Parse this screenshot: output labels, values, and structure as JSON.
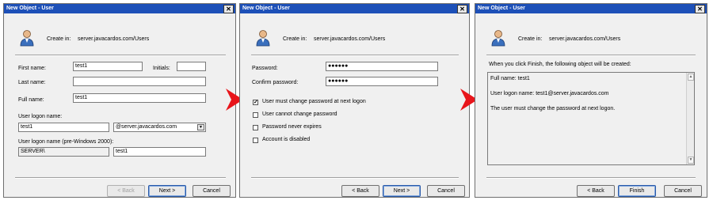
{
  "dialog1": {
    "title": "New Object - User",
    "create_in_label": "Create in:",
    "create_in_path": "server.javacardos.com/Users",
    "first_name_label": "First name:",
    "first_name_value": "test1",
    "initials_label": "Initials:",
    "initials_value": "",
    "last_name_label": "Last name:",
    "last_name_value": "",
    "full_name_label": "Full name:",
    "full_name_value": "test1",
    "logon_name_label": "User logon name:",
    "logon_name_value": "test1",
    "domain_value": "@server.javacardos.com",
    "pre2000_label": "User logon name (pre-Windows 2000):",
    "pre2000_domain_value": "SERVER\\",
    "pre2000_name_value": "test1",
    "back_label": "< Back",
    "next_label": "Next >",
    "cancel_label": "Cancel"
  },
  "dialog2": {
    "title": "New Object - User",
    "create_in_label": "Create in:",
    "create_in_path": "server.javacardos.com/Users",
    "password_label": "Password:",
    "password_value": "●●●●●●",
    "confirm_label": "Confirm password:",
    "confirm_value": "●●●●●●",
    "options": [
      {
        "label": "User must change password at next logon",
        "checked": true
      },
      {
        "label": "User cannot change password",
        "checked": false
      },
      {
        "label": "Password never expires",
        "checked": false
      },
      {
        "label": "Account is disabled",
        "checked": false
      }
    ],
    "back_label": "< Back",
    "next_label": "Next >",
    "cancel_label": "Cancel"
  },
  "dialog3": {
    "title": "New Object - User",
    "create_in_label": "Create in:",
    "create_in_path": "server.javacardos.com/Users",
    "intro": "When you click Finish, the following object will be created:",
    "summary_lines": [
      "Full name: test1",
      "User logon name: test1@server.javacardos.com",
      "The user must change the password at next logon."
    ],
    "back_label": "< Back",
    "finish_label": "Finish",
    "cancel_label": "Cancel"
  },
  "colors": {
    "titlebar": "#1d50b8",
    "arrow": "#e8151b",
    "dialog_bg": "#f0f0f0"
  },
  "icons": [
    "user-icon",
    "close-icon",
    "arrow-right-icon",
    "dropdown-arrow-icon",
    "scroll-up-icon",
    "scroll-down-icon",
    "check-icon"
  ]
}
